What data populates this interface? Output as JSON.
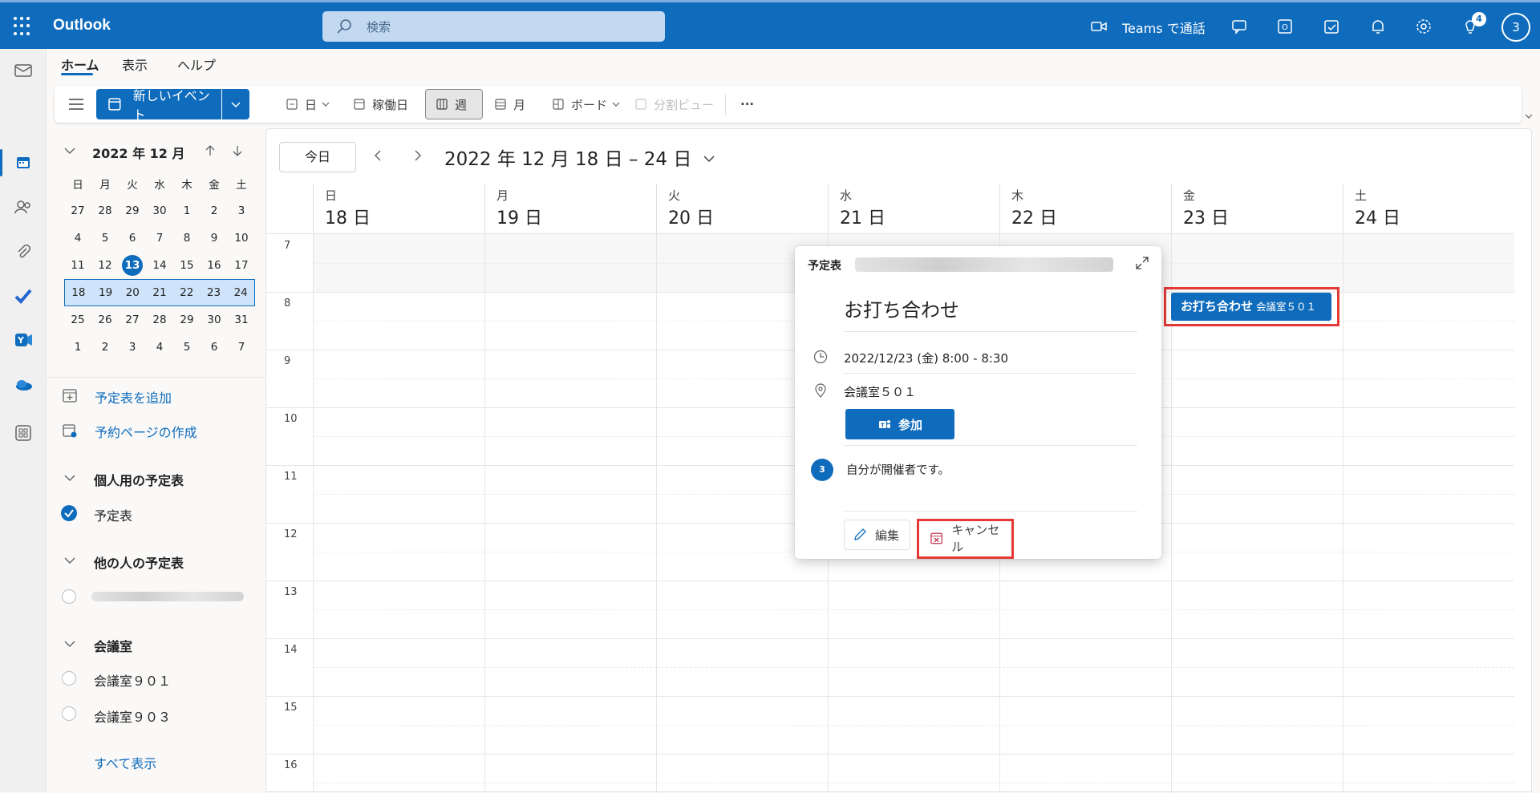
{
  "app": {
    "name": "Outlook"
  },
  "search": {
    "placeholder": "検索"
  },
  "topbar": {
    "teams_call": "Teams で通話",
    "tips_badge": "4",
    "avatar": "3"
  },
  "tabs": [
    {
      "label": "ホーム",
      "active": true
    },
    {
      "label": "表示"
    },
    {
      "label": "ヘルプ"
    }
  ],
  "ribbon": {
    "new_event": "新しいイベント",
    "day": "日",
    "workweek": "稼働日",
    "week": "週",
    "month": "月",
    "board": "ボード",
    "split": "分割ビュー",
    "more": "···"
  },
  "minical": {
    "title": "2022 年 12 月",
    "dow": [
      "日",
      "月",
      "火",
      "水",
      "木",
      "金",
      "土"
    ],
    "weeks": [
      [
        "27",
        "28",
        "29",
        "30",
        "1",
        "2",
        "3"
      ],
      [
        "4",
        "5",
        "6",
        "7",
        "8",
        "9",
        "10"
      ],
      [
        "11",
        "12",
        "13",
        "14",
        "15",
        "16",
        "17"
      ],
      [
        "18",
        "19",
        "20",
        "21",
        "22",
        "23",
        "24"
      ],
      [
        "25",
        "26",
        "27",
        "28",
        "29",
        "30",
        "31"
      ],
      [
        "1",
        "2",
        "3",
        "4",
        "5",
        "6",
        "7"
      ]
    ],
    "today": "13"
  },
  "sidebar": {
    "add_calendar": "予定表を追加",
    "booking_page": "予約ページの作成",
    "personal_header": "個人用の予定表",
    "personal_item": "予定表",
    "others_header": "他の人の予定表",
    "rooms_header": "会議室",
    "room1": "会議室９０１",
    "room2": "会議室９０３",
    "show_all": "すべて表示"
  },
  "calendar": {
    "today_btn": "今日",
    "range": "2022 年 12 月 18 日 – 24 日",
    "days": [
      {
        "dow": "日",
        "dom": "18 日"
      },
      {
        "dow": "月",
        "dom": "19 日"
      },
      {
        "dow": "火",
        "dom": "20 日"
      },
      {
        "dow": "水",
        "dom": "21 日"
      },
      {
        "dow": "木",
        "dom": "22 日"
      },
      {
        "dow": "金",
        "dom": "23 日"
      },
      {
        "dow": "土",
        "dom": "24 日"
      }
    ],
    "hours": [
      "7",
      "8",
      "9",
      "10",
      "11",
      "12",
      "13",
      "14",
      "15",
      "16"
    ]
  },
  "event": {
    "title": "お打ち合わせ",
    "location": "会議室５０１"
  },
  "popup": {
    "calendar_label": "予定表",
    "title": "お打ち合わせ",
    "datetime": "2022/12/23 (金) 8:00 - 8:30",
    "location": "会議室５０１",
    "join": "参加",
    "organizer_avatar": "3",
    "organizer_text": "自分が開催者です。",
    "edit": "編集",
    "cancel": "キャンセル"
  },
  "colors": {
    "brand": "#0f6cbd",
    "highlight": "#e53935"
  }
}
